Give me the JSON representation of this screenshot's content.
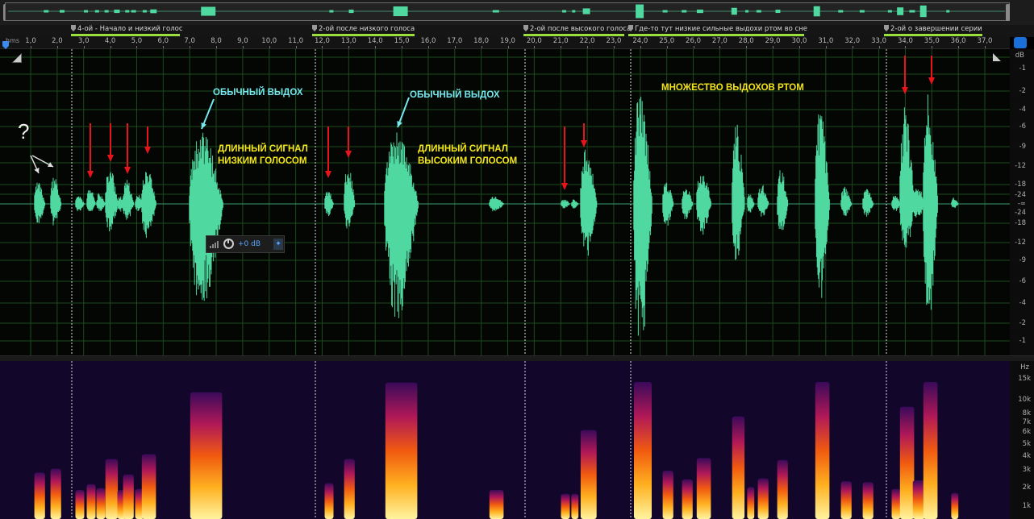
{
  "ruler": {
    "unit_label": "hms",
    "ticks": [
      "1,0",
      "2,0",
      "3,0",
      "4,0",
      "5,0",
      "6,0",
      "7,0",
      "8,0",
      "9,0",
      "10,0",
      "11,0",
      "12,0",
      "13,0",
      "14,0",
      "15,0",
      "16,0",
      "17,0",
      "18,0",
      "19,0",
      "20,0",
      "21,0",
      "22,0",
      "23,0",
      "24,0",
      "25,0",
      "26,0",
      "27,0",
      "28,0",
      "29,0",
      "30,0",
      "31,0",
      "32,0",
      "33,0",
      "34,0",
      "35,0",
      "36,0",
      "37,0"
    ]
  },
  "markers": [
    {
      "label": "4-ой - Начало и низкий голос"
    },
    {
      "label": "2-ой после низкого голоса"
    },
    {
      "label": "2-ой после высокого голоса"
    },
    {
      "label": "Где-то тут низкие сильные выдохи ртом во сне"
    },
    {
      "label": "2-ой о завершении серии"
    }
  ],
  "db_scale": {
    "unit": "dB",
    "labels": [
      "-1",
      "-2",
      "-4",
      "-6",
      "-9",
      "-12",
      "-18",
      "-24",
      "-∞",
      "-24",
      "-18",
      "-12",
      "-9",
      "-6",
      "-4",
      "-2",
      "-1"
    ]
  },
  "hz_scale": {
    "unit": "Hz",
    "labels": [
      "15k",
      "10k",
      "8k",
      "7k",
      "6k",
      "5k",
      "4k",
      "3k",
      "2k",
      "1k"
    ]
  },
  "annotations": {
    "question": "?",
    "normal_exhale_1": "ОБЫЧНЫЙ ВЫДОХ",
    "normal_exhale_2": "ОБЫЧНЫЙ ВЫДОХ",
    "long_low_1": "ДЛИННЫЙ СИГНАЛ",
    "long_low_2": "НИЗКИМ ГОЛОСОМ",
    "long_high_1": "ДЛИННЫЙ СИГНАЛ",
    "long_high_2": "ВЫСОКИМ ГОЛОСОМ",
    "many_exhales": "МНОЖЕСТВО ВЫДОХОВ РТОМ"
  },
  "volume_widget": {
    "gain": "+0 dB",
    "knob_icon": "power-knob-icon",
    "pin_icon": "pin-icon",
    "level_icon": "level-bars-icon"
  },
  "colors": {
    "waveform": "#4fd8a0",
    "grid": "#1e4a1e",
    "arrow_red": "#e8141a",
    "arrow_cyan": "#76e8ee",
    "text_yellow": "#f4e418",
    "marker_bar": "#9bdf3e"
  }
}
